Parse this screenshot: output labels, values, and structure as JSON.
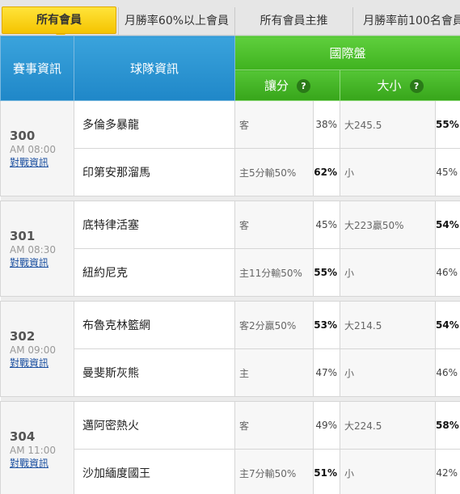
{
  "tabs": [
    "所有會員",
    "月勝率60%以上會員",
    "所有會員主推",
    "月勝率前100名會員"
  ],
  "header": {
    "event": "賽事資訊",
    "team": "球隊資訊",
    "intl": "國際盤",
    "handicap": "讓分",
    "overunder": "大小",
    "help": "?"
  },
  "matches": [
    {
      "num": "300",
      "time": "AM 08:00",
      "link": "對戰資訊",
      "rows": [
        {
          "team": "多倫多暴龍",
          "hcap": "客",
          "hpct": "38%",
          "ou": "大245.5",
          "opct": "55%"
        },
        {
          "team": "印第安那溜馬",
          "hcap": "主5分輸50%",
          "hpct": "62%",
          "ou": "小",
          "opct": "45%"
        }
      ]
    },
    {
      "num": "301",
      "time": "AM 08:30",
      "link": "對戰資訊",
      "rows": [
        {
          "team": "底特律活塞",
          "hcap": "客",
          "hpct": "45%",
          "ou": "大223贏50%",
          "opct": "54%"
        },
        {
          "team": "紐約尼克",
          "hcap": "主11分輸50%",
          "hpct": "55%",
          "ou": "小",
          "opct": "46%"
        }
      ]
    },
    {
      "num": "302",
      "time": "AM 09:00",
      "link": "對戰資訊",
      "rows": [
        {
          "team": "布魯克林籃網",
          "hcap": "客2分贏50%",
          "hpct": "53%",
          "ou": "大214.5",
          "opct": "54%"
        },
        {
          "team": "曼斐斯灰熊",
          "hcap": "主",
          "hpct": "47%",
          "ou": "小",
          "opct": "46%"
        }
      ]
    },
    {
      "num": "304",
      "time": "AM 11:00",
      "link": "對戰資訊",
      "rows": [
        {
          "team": "邁阿密熱火",
          "hcap": "客",
          "hpct": "49%",
          "ou": "大224.5",
          "opct": "58%"
        },
        {
          "team": "沙加緬度國王",
          "hcap": "主7分輸50%",
          "hpct": "51%",
          "ou": "小",
          "opct": "42%"
        }
      ]
    }
  ]
}
